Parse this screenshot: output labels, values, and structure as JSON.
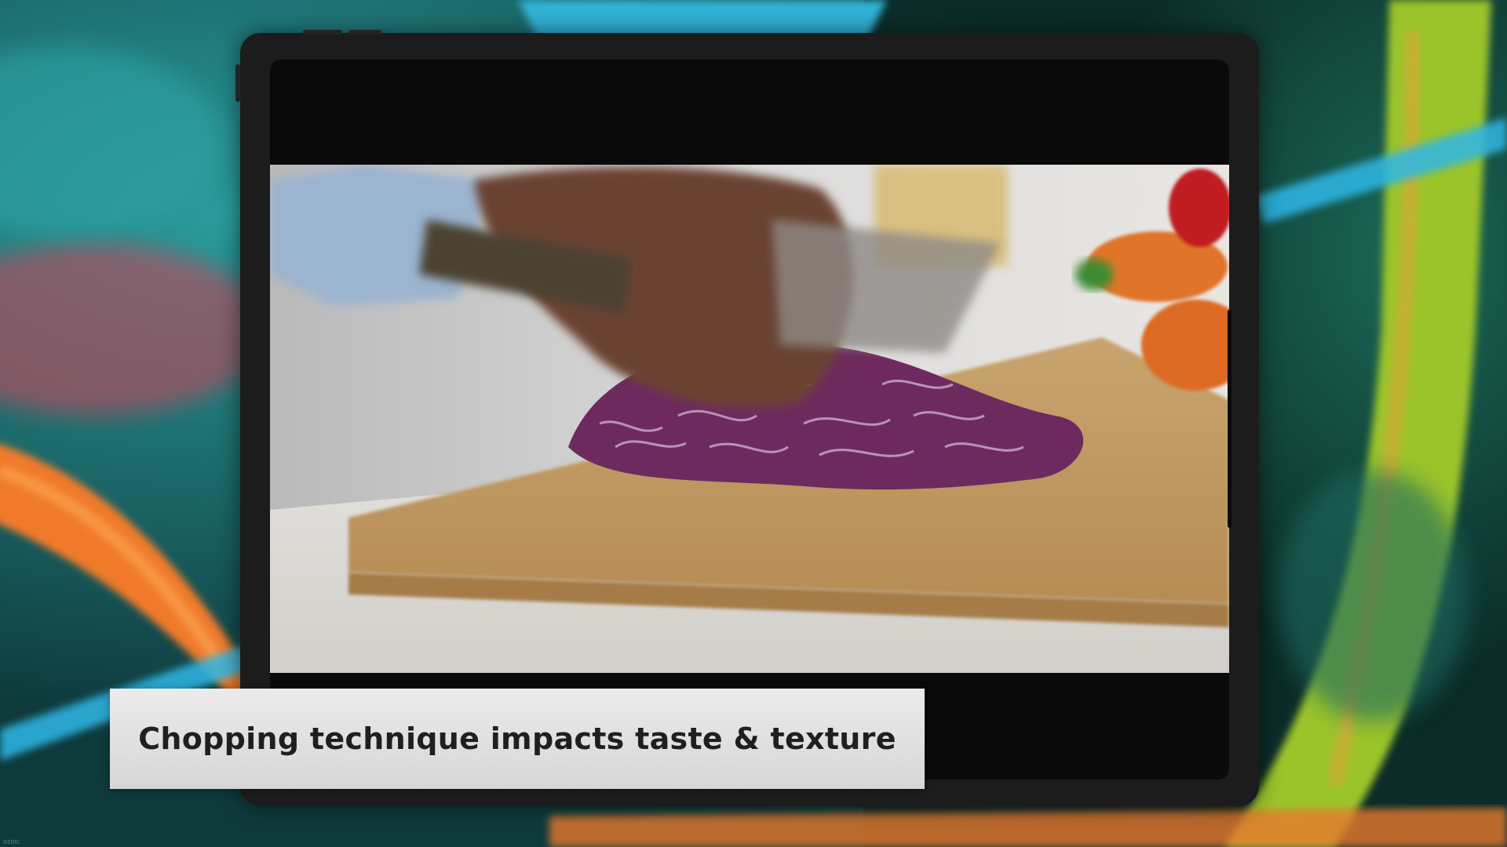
{
  "caption": {
    "text": "Chopping technique impacts taste & texture"
  },
  "watermark": {
    "text": "ezoic"
  },
  "scene": {
    "description_icon": "cutting-board-red-cabbage",
    "colors": {
      "background_teal": "#1f8a8c",
      "background_orange": "#f07a2c",
      "background_green": "#9ac52c",
      "cabbage_purple": "#6e2a5e",
      "board_wood": "#c9a46e",
      "caption_bg": "#e3e3e3"
    }
  }
}
